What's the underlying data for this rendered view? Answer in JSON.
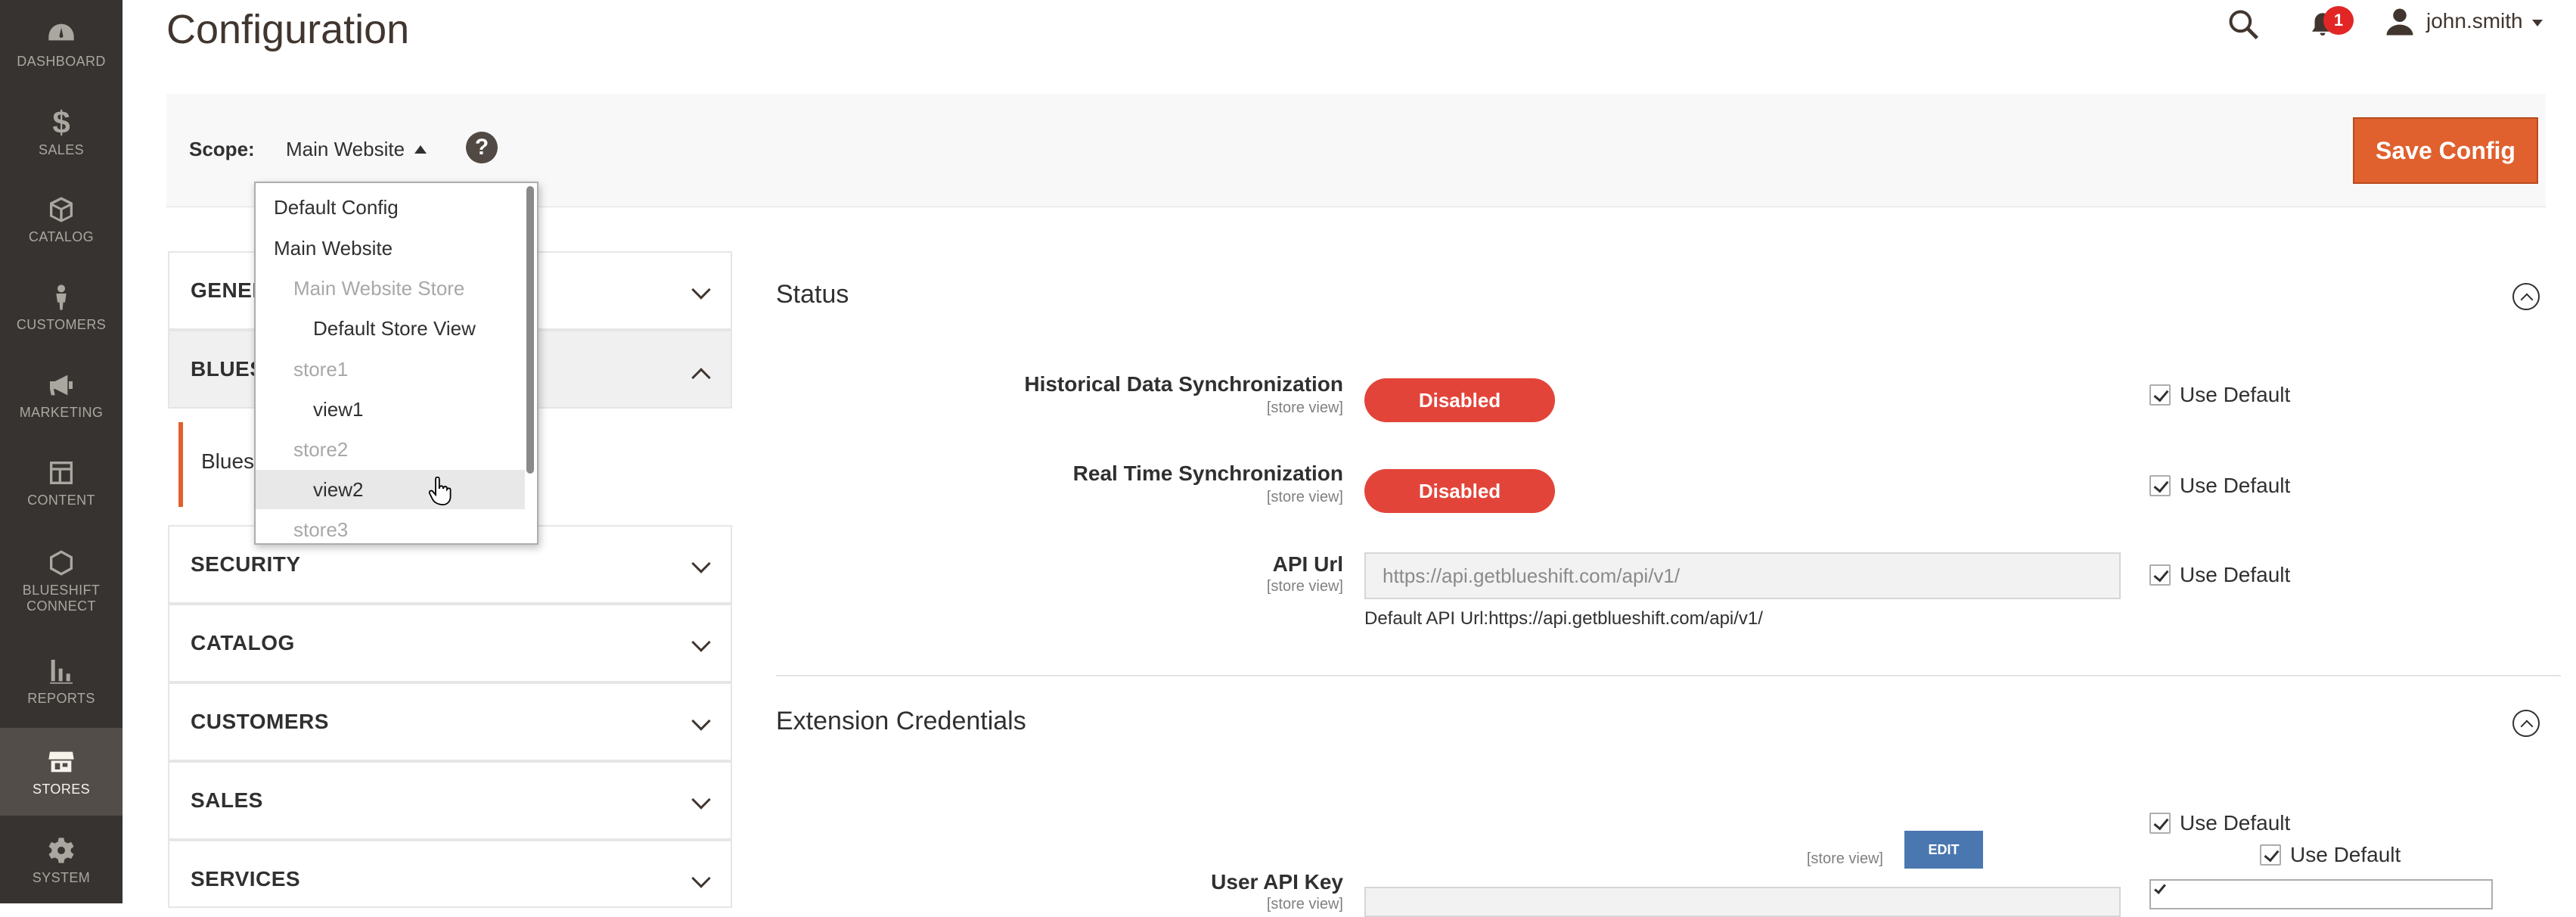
{
  "nav": {
    "items": [
      {
        "label": "DASHBOARD",
        "icon": "dashboard-icon"
      },
      {
        "label": "$",
        "icon": "sales-icon",
        "sub": "SALES"
      },
      {
        "label": "CATALOG",
        "icon": "catalog-icon"
      },
      {
        "label": "CUSTOMERS",
        "icon": "customers-icon"
      },
      {
        "label": "MARKETING",
        "icon": "marketing-icon"
      },
      {
        "label": "CONTENT",
        "icon": "content-icon"
      },
      {
        "label": "BLUESHIFT CONNECT",
        "icon": "blueshift-icon"
      },
      {
        "label": "REPORTS",
        "icon": "reports-icon"
      },
      {
        "label": "STORES",
        "icon": "stores-icon"
      },
      {
        "label": "SYSTEM",
        "icon": "system-icon"
      }
    ]
  },
  "header": {
    "title": "Configuration",
    "notification_count": "1",
    "user": "john.smith"
  },
  "scope": {
    "label": "Scope:",
    "value": "Main Website",
    "help": "?",
    "save_label": "Save Config"
  },
  "dropdown": {
    "options": [
      {
        "label": "Default Config",
        "level": 0
      },
      {
        "label": "Main Website",
        "level": 0
      },
      {
        "label": "Main Website Store",
        "level": 1,
        "disabled": true
      },
      {
        "label": "Default Store View",
        "level": 2
      },
      {
        "label": "store1",
        "level": 1,
        "disabled": true
      },
      {
        "label": "view1",
        "level": 2
      },
      {
        "label": "store2",
        "level": 1,
        "disabled": true
      },
      {
        "label": "view2",
        "level": 2,
        "hover": true
      },
      {
        "label": "store3",
        "level": 1,
        "disabled": true
      }
    ]
  },
  "tabs": {
    "general": "GENER",
    "blueshift": "BLUES",
    "blueshift_sub": "Bluesl",
    "security": "SECURITY",
    "catalog": "CATALOG",
    "customers": "CUSTOMERS",
    "sales": "SALES",
    "services": "SERVICES"
  },
  "status": {
    "title": "Status",
    "historical_label": "Historical Data Synchronization",
    "historical_scope": "[store view]",
    "historical_value": "Disabled",
    "realtime_label": "Real Time Synchronization",
    "realtime_scope": "[store view]",
    "realtime_value": "Disabled",
    "api_label": "API Url",
    "api_scope": "[store view]",
    "api_value": "https://api.getblueshift.com/api/v1/",
    "api_note": "Default API Url:https://api.getblueshift.com/api/v1/",
    "use_default": "Use Default"
  },
  "credentials": {
    "title": "Extension Credentials",
    "use_default": "Use Default",
    "scope": "[store view]",
    "edit": "EDIT",
    "user_api_key_label": "User API Key",
    "user_api_key_scope": "[store view]"
  },
  "colors": {
    "nav_bg": "#373330",
    "accent": "#e0602e",
    "disabled_pill": "#e3443a",
    "edit_button": "#4a77b0"
  }
}
